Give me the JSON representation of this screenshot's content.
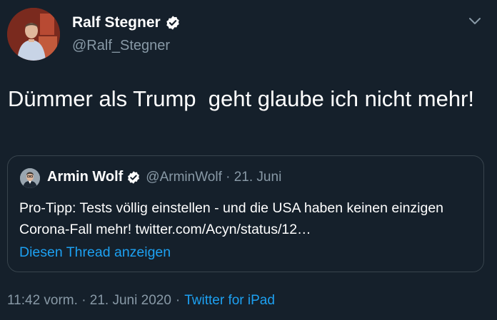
{
  "author": {
    "display_name": "Ralf Stegner",
    "handle": "@Ralf_Stegner",
    "avatar_icon": "profile-photo",
    "verified_icon": "verified-badge-icon"
  },
  "tweet": {
    "text": "Dümmer als Trump  geht glaube ich nicht mehr!"
  },
  "quoted_tweet": {
    "display_name": "Armin Wolf",
    "meta": "@ArminWolf · 21. Juni",
    "text": "Pro-Tipp: Tests völlig einstellen - und die USA haben keinen einzigen Corona-Fall mehr! twitter.com/Acyn/status/12…",
    "thread_link": "Diesen Thread anzeigen"
  },
  "footer": {
    "timestamp": "11:42 vorm. · 21. Juni 2020",
    "separator": "·",
    "source": "Twitter for iPad"
  },
  "colors": {
    "background": "#15202b",
    "text": "#ffffff",
    "secondary": "#8899a6",
    "link": "#1da1f2",
    "border": "#38444d"
  }
}
